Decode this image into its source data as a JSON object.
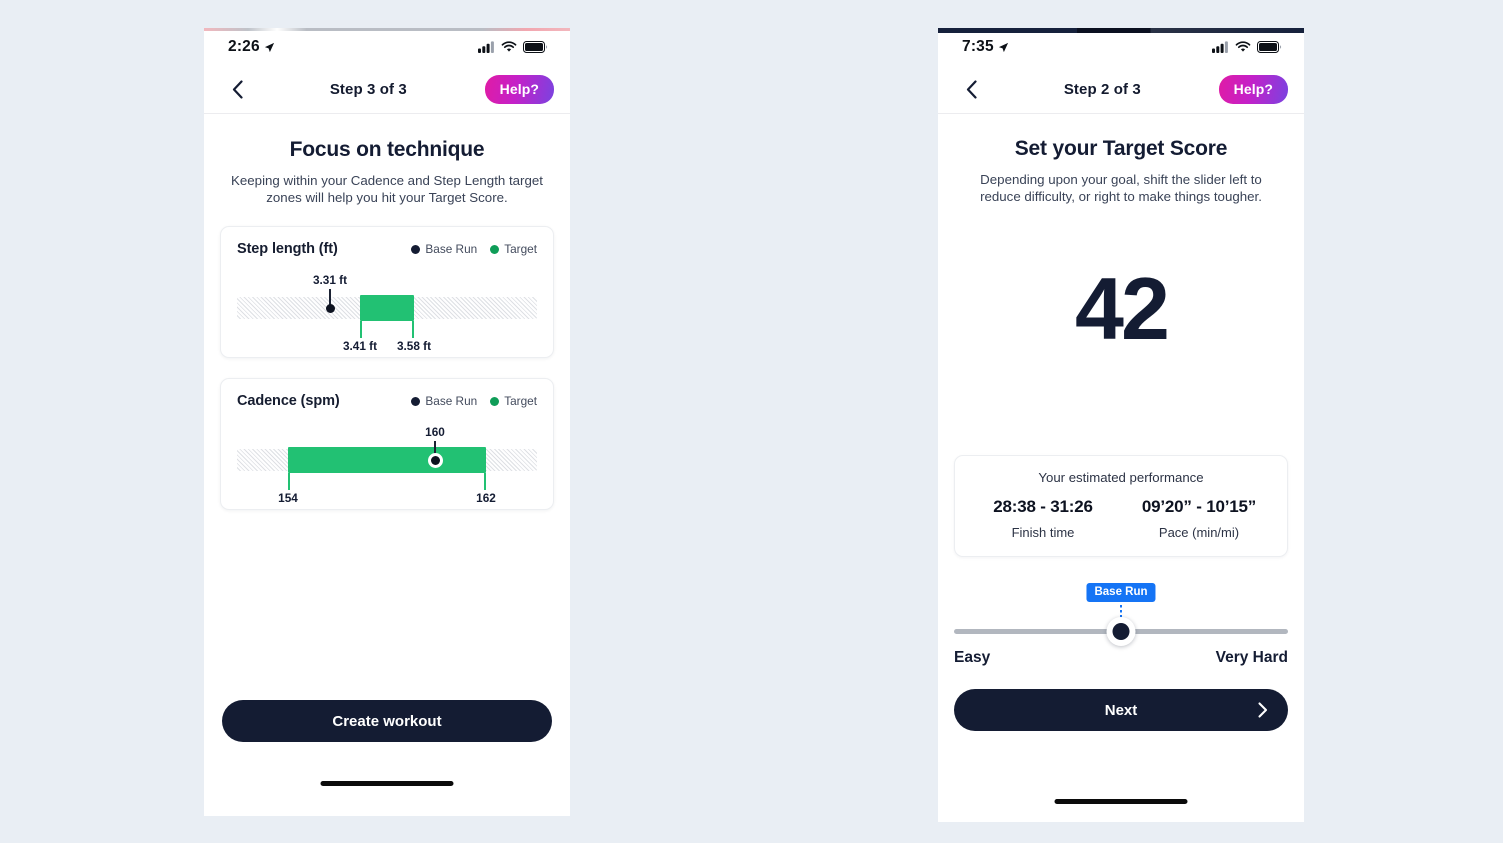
{
  "colors": {
    "page_background": "#e9eef4",
    "navy": "#141c33",
    "green_bar": "#22c173",
    "green_legend": "#0f9d58",
    "badge_blue": "#1574f5",
    "track_gray": "#f4f5f7",
    "help_gradient_start": "#e01ca5",
    "help_gradient_end": "#7a43e0"
  },
  "left_phone": {
    "status": {
      "time": "2:26",
      "location_icon": "location-arrow-icon",
      "cellular_icon": "cellular-bars-icon",
      "wifi_icon": "wifi-icon",
      "battery_icon": "battery-full-icon"
    },
    "nav": {
      "back_icon": "chevron-left-icon",
      "title": "Step 3 of 3",
      "help_label": "Help?"
    },
    "title": "Focus on technique",
    "subtitle": "Keeping within your Cadence and Step Length target zones will help you hit your Target Score.",
    "cards": [
      {
        "title": "Step length (ft)",
        "legend": [
          {
            "label": "Base Run",
            "color": "#141c33"
          },
          {
            "label": "Target",
            "color": "#0f9d58"
          }
        ],
        "base_value": "3.31 ft",
        "range_low": "3.41 ft",
        "range_high": "3.58 ft"
      },
      {
        "title": "Cadence (spm)",
        "legend": [
          {
            "label": "Base Run",
            "color": "#141c33"
          },
          {
            "label": "Target",
            "color": "#0f9d58"
          }
        ],
        "base_value": "160",
        "range_low": "154",
        "range_high": "162"
      }
    ],
    "primary_button": {
      "label": "Create workout"
    }
  },
  "right_phone": {
    "status": {
      "time": "7:35",
      "location_icon": "location-arrow-icon",
      "cellular_icon": "cellular-bars-icon",
      "wifi_icon": "wifi-icon",
      "battery_icon": "battery-full-icon"
    },
    "nav": {
      "back_icon": "chevron-left-icon",
      "title": "Step 2 of 3",
      "help_label": "Help?"
    },
    "title": "Set your Target Score",
    "subtitle": "Depending upon your goal, shift the slider left to reduce difficulty, or right to make things tougher.",
    "score": "42",
    "performance": {
      "caption": "Your estimated performance",
      "finish_time_value": "28:38 - 31:26",
      "finish_time_label": "Finish time",
      "pace_value": "09’20” - 10’15”",
      "pace_label": "Pace (min/mi)"
    },
    "slider": {
      "badge": "Base Run",
      "left_label": "Easy",
      "right_label": "Very Hard",
      "position_percent": 50
    },
    "primary_button": {
      "label": "Next",
      "icon": "chevron-right-icon"
    }
  },
  "chart_data": [
    {
      "type": "bar",
      "title": "Step length (ft)",
      "unit": "ft",
      "xlabel": "",
      "ylabel": "",
      "legend": [
        "Base Run",
        "Target"
      ],
      "legend_position": "top-right",
      "grid": false,
      "series": [
        {
          "name": "Base Run",
          "type": "marker",
          "value": 3.31,
          "label": "3.31 ft"
        },
        {
          "name": "Target",
          "type": "range",
          "low": 3.41,
          "high": 3.58,
          "low_label": "3.41 ft",
          "high_label": "3.58 ft"
        }
      ],
      "axis_range_estimate": [
        3.1,
        3.95
      ],
      "marker_position_percent": 31,
      "range_start_percent": 41,
      "range_end_percent": 59
    },
    {
      "type": "bar",
      "title": "Cadence (spm)",
      "unit": "spm",
      "xlabel": "",
      "ylabel": "",
      "legend": [
        "Base Run",
        "Target"
      ],
      "legend_position": "top-right",
      "grid": false,
      "series": [
        {
          "name": "Base Run",
          "type": "marker",
          "value": 160,
          "label": "160"
        },
        {
          "name": "Target",
          "type": "range",
          "low": 154,
          "high": 162,
          "low_label": "154",
          "high_label": "162"
        }
      ],
      "axis_range_estimate": [
        150,
        166
      ],
      "marker_position_percent": 66,
      "range_start_percent": 17,
      "range_end_percent": 83
    }
  ]
}
